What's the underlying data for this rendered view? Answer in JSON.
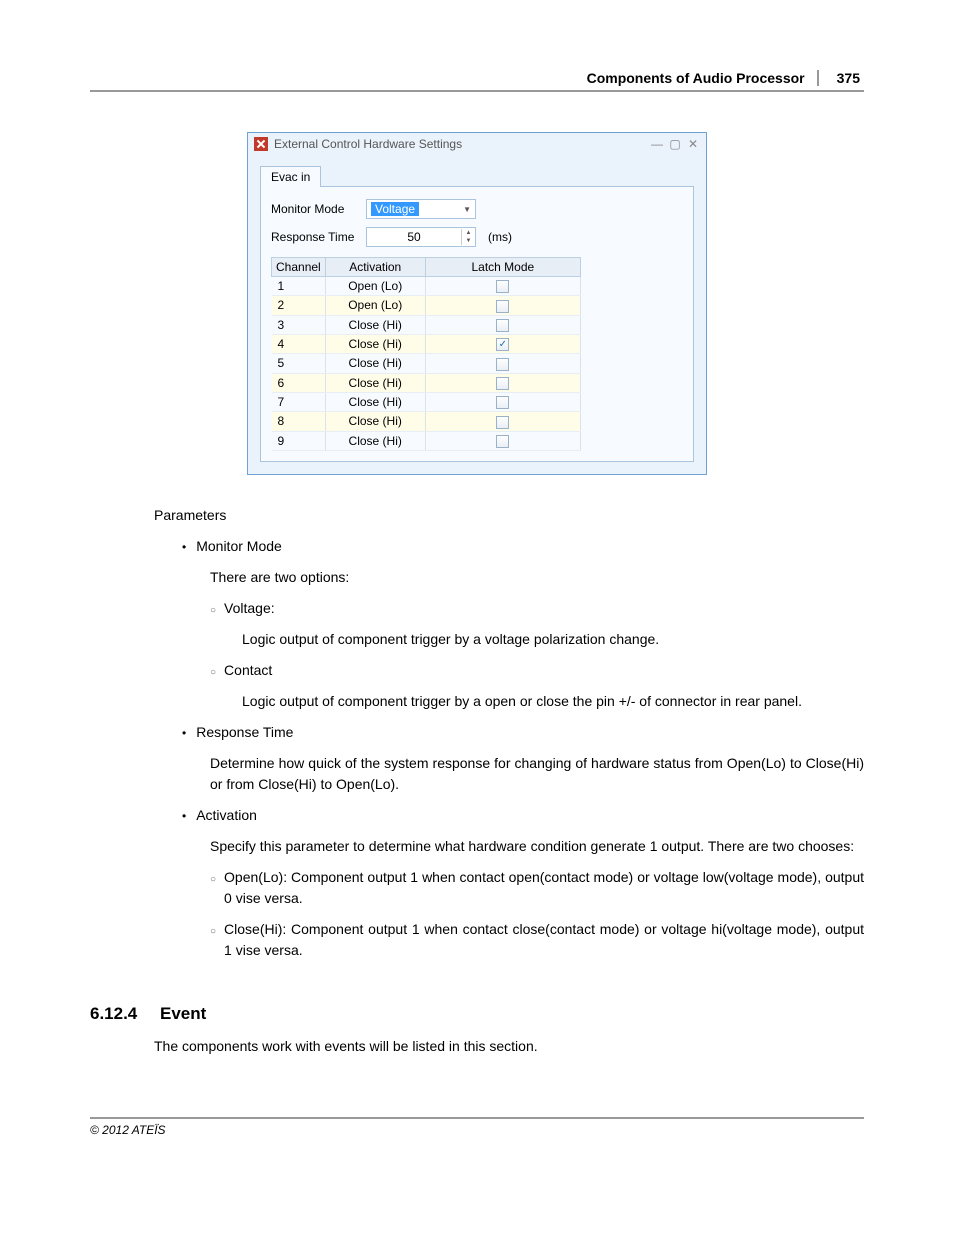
{
  "header": {
    "title": "Components of Audio Processor",
    "page_num": "375"
  },
  "dialog": {
    "title": "External Control Hardware Settings",
    "tab": "Evac in",
    "monitor_mode": {
      "label": "Monitor Mode",
      "value": "Voltage"
    },
    "response_time": {
      "label": "Response Time",
      "value": "50",
      "unit": "(ms)"
    },
    "table": {
      "cols": [
        "Channel",
        "Activation",
        "Latch Mode"
      ],
      "rows": [
        {
          "channel": "1",
          "activation": "Open (Lo)",
          "latch": false
        },
        {
          "channel": "2",
          "activation": "Open (Lo)",
          "latch": false
        },
        {
          "channel": "3",
          "activation": "Close (Hi)",
          "latch": false
        },
        {
          "channel": "4",
          "activation": "Close (Hi)",
          "latch": true
        },
        {
          "channel": "5",
          "activation": "Close (Hi)",
          "latch": false
        },
        {
          "channel": "6",
          "activation": "Close (Hi)",
          "latch": false
        },
        {
          "channel": "7",
          "activation": "Close (Hi)",
          "latch": false
        },
        {
          "channel": "8",
          "activation": "Close (Hi)",
          "latch": false
        },
        {
          "channel": "9",
          "activation": "Close (Hi)",
          "latch": false
        }
      ]
    }
  },
  "body": {
    "parameters_heading": "Parameters",
    "monitor_mode": {
      "title": "Monitor Mode",
      "intro": "There are two options:",
      "voltage_title": "Voltage:",
      "voltage_desc": "Logic output of component trigger by a voltage polarization change.",
      "contact_title": "Contact",
      "contact_desc": "Logic output of component trigger by a open or close the pin +/- of connector in rear panel."
    },
    "response_time": {
      "title": "Response Time",
      "desc": "Determine how quick of the system response for changing of hardware status from Open(Lo) to Close(Hi) or from Close(Hi) to Open(Lo)."
    },
    "activation": {
      "title": "Activation",
      "intro": "Specify this parameter to determine what hardware condition generate 1 output. There are two chooses:",
      "open_desc": "Open(Lo): Component output 1 when contact open(contact mode) or voltage low(voltage mode), output 0 vise versa.",
      "close_desc": "Close(Hi): Component output 1 when contact close(contact mode) or voltage hi(voltage mode), output 1 vise versa."
    }
  },
  "section": {
    "num": "6.12.4",
    "title": "Event",
    "text": "The components work with events will be listed in this section."
  },
  "footer": "© 2012 ATEÏS"
}
